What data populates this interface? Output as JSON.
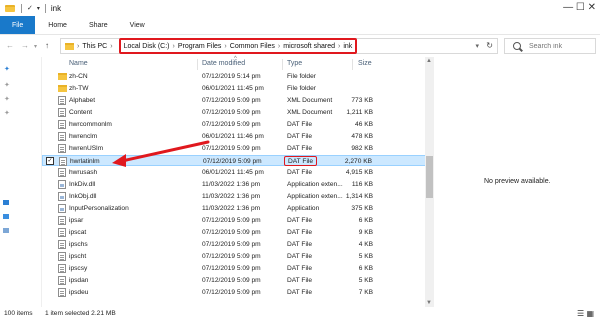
{
  "window": {
    "title": "ink",
    "controls": "— ☐ ✕"
  },
  "ribbon": {
    "tabs": [
      "File",
      "Home",
      "Share",
      "View"
    ]
  },
  "address": {
    "root": "This PC",
    "crumbs": [
      "Local Disk (C:)",
      "Program Files",
      "Common Files",
      "microsoft shared",
      "ink"
    ]
  },
  "search": {
    "placeholder": "Search ink"
  },
  "columns": {
    "name": "Name",
    "date": "Date modified",
    "type": "Type",
    "size": "Size"
  },
  "files": [
    {
      "name": "zh-CN",
      "date": "07/12/2019 5:14 pm",
      "type": "File folder",
      "size": "",
      "kind": "folder"
    },
    {
      "name": "zh-TW",
      "date": "06/01/2021 11:45 pm",
      "type": "File folder",
      "size": "",
      "kind": "folder"
    },
    {
      "name": "Alphabet",
      "date": "07/12/2019 5:09 pm",
      "type": "XML Document",
      "size": "773 KB",
      "kind": "doc"
    },
    {
      "name": "Content",
      "date": "07/12/2019 5:09 pm",
      "type": "XML Document",
      "size": "1,211 KB",
      "kind": "doc"
    },
    {
      "name": "hwrcommonlm",
      "date": "07/12/2019 5:09 pm",
      "type": "DAT File",
      "size": "46 KB",
      "kind": "doc"
    },
    {
      "name": "hwrenclm",
      "date": "06/01/2021 11:46 pm",
      "type": "DAT File",
      "size": "478 KB",
      "kind": "doc"
    },
    {
      "name": "hwrenUSlm",
      "date": "07/12/2019 5:09 pm",
      "type": "DAT File",
      "size": "982 KB",
      "kind": "doc"
    },
    {
      "name": "hwrlatinlm",
      "date": "07/12/2019 5:09 pm",
      "type": "DAT File",
      "size": "2,270 KB",
      "kind": "doc",
      "selected": true
    },
    {
      "name": "hwrusash",
      "date": "06/01/2021 11:45 pm",
      "type": "DAT File",
      "size": "4,915 KB",
      "kind": "doc"
    },
    {
      "name": "InkDiv.dll",
      "date": "11/03/2022 1:36 pm",
      "type": "Application exten...",
      "size": "116 KB",
      "kind": "dll"
    },
    {
      "name": "InkObj.dll",
      "date": "11/03/2022 1:36 pm",
      "type": "Application exten...",
      "size": "1,314 KB",
      "kind": "dll"
    },
    {
      "name": "InputPersonalization",
      "date": "11/03/2022 1:36 pm",
      "type": "Application",
      "size": "375 KB",
      "kind": "dll"
    },
    {
      "name": "ipsar",
      "date": "07/12/2019 5:09 pm",
      "type": "DAT File",
      "size": "6 KB",
      "kind": "doc"
    },
    {
      "name": "ipscat",
      "date": "07/12/2019 5:09 pm",
      "type": "DAT File",
      "size": "9 KB",
      "kind": "doc"
    },
    {
      "name": "ipschs",
      "date": "07/12/2019 5:09 pm",
      "type": "DAT File",
      "size": "4 KB",
      "kind": "doc"
    },
    {
      "name": "ipscht",
      "date": "07/12/2019 5:09 pm",
      "type": "DAT File",
      "size": "5 KB",
      "kind": "doc"
    },
    {
      "name": "ipscsy",
      "date": "07/12/2019 5:09 pm",
      "type": "DAT File",
      "size": "6 KB",
      "kind": "doc"
    },
    {
      "name": "ipsdan",
      "date": "07/12/2019 5:09 pm",
      "type": "DAT File",
      "size": "5 KB",
      "kind": "doc"
    },
    {
      "name": "ipsdeu",
      "date": "07/12/2019 5:09 pm",
      "type": "DAT File",
      "size": "7 KB",
      "kind": "doc"
    }
  ],
  "preview": {
    "message": "No preview available."
  },
  "status": {
    "items": "100 items",
    "selected": "1 item selected  2.21 MB"
  },
  "colors": {
    "accent": "#1979ca",
    "highlight": "#e0181e",
    "selection": "#cce8ff",
    "folder": "#f5c540"
  }
}
